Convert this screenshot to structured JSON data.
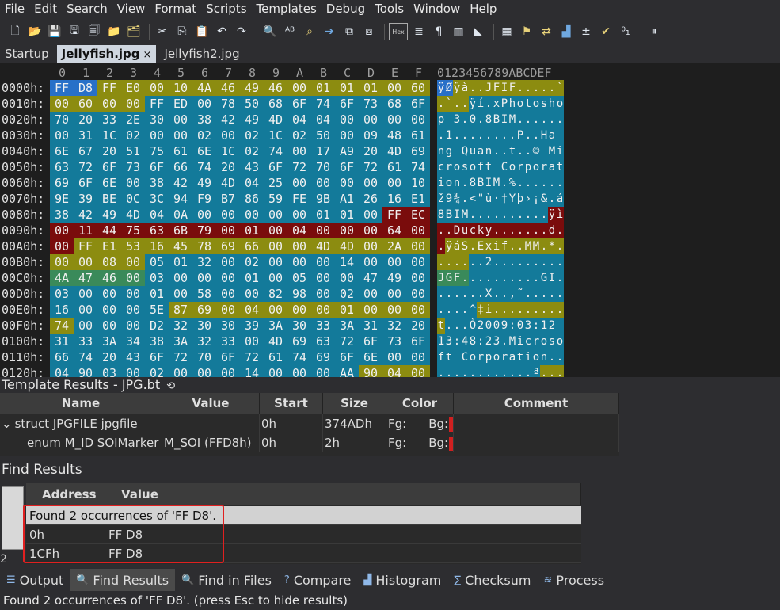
{
  "menu": [
    "File",
    "Edit",
    "Search",
    "View",
    "Format",
    "Scripts",
    "Templates",
    "Debug",
    "Tools",
    "Window",
    "Help"
  ],
  "toolbar": {
    "icons": [
      "new-file-icon",
      "open-icon",
      "save-icon",
      "save-as-icon",
      "save-all-icon",
      "open-folder-icon",
      "open-project-icon",
      "cut-icon",
      "copy-icon",
      "paste-icon",
      "undo-icon",
      "redo-icon",
      "find-icon",
      "replace-icon",
      "find-in-files-icon",
      "goto-icon",
      "compare-icon",
      "compare2-icon",
      "hex-icon",
      "text-format-icon",
      "pilcrow-icon",
      "columns-icon",
      "highlight-icon",
      "calculator-icon",
      "bookmark-icon",
      "swap-icon",
      "histogram-icon",
      "checksum-icon",
      "check-icon",
      "base-convert-icon",
      "pause-icon"
    ],
    "hex_label": "Hex"
  },
  "tabs": [
    {
      "label": "Startup",
      "active": false
    },
    {
      "label": "Jellyfish.jpg",
      "active": true,
      "close": "×"
    },
    {
      "label": "Jellyfish2.jpg",
      "active": false
    }
  ],
  "hex": {
    "col_headers": [
      "0",
      "1",
      "2",
      "3",
      "4",
      "5",
      "6",
      "7",
      "8",
      "9",
      "A",
      "B",
      "C",
      "D",
      "E",
      "F"
    ],
    "ascii_header": "0123456789ABCDEF",
    "colors": {
      "blue": "#2870c8",
      "olive": "#8c8c10",
      "teal": "#137a9a",
      "red": "#7a0c0c",
      "green": "#3a8a5a",
      "dark": "#1e1e1e"
    },
    "rows": [
      {
        "addr": "0000h:",
        "bytes": [
          "FF",
          "D8",
          "FF",
          "E0",
          "00",
          "10",
          "4A",
          "46",
          "49",
          "46",
          "00",
          "01",
          "01",
          "01",
          "00",
          "60"
        ],
        "ascii": "ÿØÿà..JFIF.....`",
        "fill": [
          "blue",
          "blue",
          "olive",
          "olive",
          "olive",
          "olive",
          "olive",
          "olive",
          "olive",
          "olive",
          "olive",
          "olive",
          "olive",
          "olive",
          "olive",
          "olive"
        ]
      },
      {
        "addr": "0010h:",
        "bytes": [
          "00",
          "60",
          "00",
          "00",
          "FF",
          "ED",
          "00",
          "78",
          "50",
          "68",
          "6F",
          "74",
          "6F",
          "73",
          "68",
          "6F"
        ],
        "ascii": ".`..ÿí.xPhotosho",
        "fill": [
          "olive",
          "olive",
          "olive",
          "olive",
          "teal",
          "teal",
          "teal",
          "teal",
          "teal",
          "teal",
          "teal",
          "teal",
          "teal",
          "teal",
          "teal",
          "teal"
        ]
      },
      {
        "addr": "0020h:",
        "bytes": [
          "70",
          "20",
          "33",
          "2E",
          "30",
          "00",
          "38",
          "42",
          "49",
          "4D",
          "04",
          "04",
          "00",
          "00",
          "00",
          "00"
        ],
        "ascii": "p 3.0.8BIM......",
        "fill": [
          "teal",
          "teal",
          "teal",
          "teal",
          "teal",
          "teal",
          "teal",
          "teal",
          "teal",
          "teal",
          "teal",
          "teal",
          "teal",
          "teal",
          "teal",
          "teal"
        ]
      },
      {
        "addr": "0030h:",
        "bytes": [
          "00",
          "31",
          "1C",
          "02",
          "00",
          "00",
          "02",
          "00",
          "02",
          "1C",
          "02",
          "50",
          "00",
          "09",
          "48",
          "61"
        ],
        "ascii": ".1........P..Ha",
        "fill": [
          "teal",
          "teal",
          "teal",
          "teal",
          "teal",
          "teal",
          "teal",
          "teal",
          "teal",
          "teal",
          "teal",
          "teal",
          "teal",
          "teal",
          "teal",
          "teal"
        ]
      },
      {
        "addr": "0040h:",
        "bytes": [
          "6E",
          "67",
          "20",
          "51",
          "75",
          "61",
          "6E",
          "1C",
          "02",
          "74",
          "00",
          "17",
          "A9",
          "20",
          "4D",
          "69"
        ],
        "ascii": "ng Quan..t..© Mi",
        "fill": [
          "teal",
          "teal",
          "teal",
          "teal",
          "teal",
          "teal",
          "teal",
          "teal",
          "teal",
          "teal",
          "teal",
          "teal",
          "teal",
          "teal",
          "teal",
          "teal"
        ]
      },
      {
        "addr": "0050h:",
        "bytes": [
          "63",
          "72",
          "6F",
          "73",
          "6F",
          "66",
          "74",
          "20",
          "43",
          "6F",
          "72",
          "70",
          "6F",
          "72",
          "61",
          "74"
        ],
        "ascii": "crosoft Corporat",
        "fill": [
          "teal",
          "teal",
          "teal",
          "teal",
          "teal",
          "teal",
          "teal",
          "teal",
          "teal",
          "teal",
          "teal",
          "teal",
          "teal",
          "teal",
          "teal",
          "teal"
        ]
      },
      {
        "addr": "0060h:",
        "bytes": [
          "69",
          "6F",
          "6E",
          "00",
          "38",
          "42",
          "49",
          "4D",
          "04",
          "25",
          "00",
          "00",
          "00",
          "00",
          "00",
          "10"
        ],
        "ascii": "ion.8BIM.%......",
        "fill": [
          "teal",
          "teal",
          "teal",
          "teal",
          "teal",
          "teal",
          "teal",
          "teal",
          "teal",
          "teal",
          "teal",
          "teal",
          "teal",
          "teal",
          "teal",
          "teal"
        ]
      },
      {
        "addr": "0070h:",
        "bytes": [
          "9E",
          "39",
          "BE",
          "0C",
          "3C",
          "94",
          "F9",
          "B7",
          "86",
          "59",
          "FE",
          "9B",
          "A1",
          "26",
          "16",
          "E1"
        ],
        "ascii": "ž9¾.<\"ù·†Yþ›¡&.á",
        "fill": [
          "teal",
          "teal",
          "teal",
          "teal",
          "teal",
          "teal",
          "teal",
          "teal",
          "teal",
          "teal",
          "teal",
          "teal",
          "teal",
          "teal",
          "teal",
          "teal"
        ]
      },
      {
        "addr": "0080h:",
        "bytes": [
          "38",
          "42",
          "49",
          "4D",
          "04",
          "0A",
          "00",
          "00",
          "00",
          "00",
          "00",
          "01",
          "01",
          "00",
          "FF",
          "EC"
        ],
        "ascii": "8BIM..........ÿì",
        "fill": [
          "teal",
          "teal",
          "teal",
          "teal",
          "teal",
          "teal",
          "teal",
          "teal",
          "teal",
          "teal",
          "teal",
          "teal",
          "teal",
          "teal",
          "red",
          "red"
        ]
      },
      {
        "addr": "0090h:",
        "bytes": [
          "00",
          "11",
          "44",
          "75",
          "63",
          "6B",
          "79",
          "00",
          "01",
          "00",
          "04",
          "00",
          "00",
          "00",
          "64",
          "00"
        ],
        "ascii": "..Ducky.......d.",
        "fill": [
          "red",
          "red",
          "red",
          "red",
          "red",
          "red",
          "red",
          "red",
          "red",
          "red",
          "red",
          "red",
          "red",
          "red",
          "red",
          "red"
        ]
      },
      {
        "addr": "00A0h:",
        "bytes": [
          "00",
          "FF",
          "E1",
          "53",
          "16",
          "45",
          "78",
          "69",
          "66",
          "00",
          "00",
          "4D",
          "4D",
          "00",
          "2A",
          "00"
        ],
        "ascii": ".ÿáS.Exif..MM.*.",
        "fill": [
          "red",
          "olive",
          "olive",
          "olive",
          "olive",
          "olive",
          "olive",
          "olive",
          "olive",
          "olive",
          "olive",
          "olive",
          "olive",
          "olive",
          "olive",
          "olive"
        ]
      },
      {
        "addr": "00B0h:",
        "bytes": [
          "00",
          "00",
          "08",
          "00",
          "05",
          "01",
          "32",
          "00",
          "02",
          "00",
          "00",
          "00",
          "14",
          "00",
          "00",
          "00"
        ],
        "ascii": "......2.........",
        "fill": [
          "olive",
          "olive",
          "olive",
          "olive",
          "teal",
          "teal",
          "teal",
          "teal",
          "teal",
          "teal",
          "teal",
          "teal",
          "teal",
          "teal",
          "teal",
          "teal"
        ]
      },
      {
        "addr": "00C0h:",
        "bytes": [
          "4A",
          "47",
          "46",
          "00",
          "03",
          "00",
          "00",
          "00",
          "01",
          "00",
          "05",
          "00",
          "00",
          "47",
          "49",
          "00"
        ],
        "ascii": "JGF..........GI.",
        "fill": [
          "green",
          "green",
          "green",
          "green",
          "teal",
          "teal",
          "teal",
          "teal",
          "teal",
          "teal",
          "teal",
          "teal",
          "teal",
          "teal",
          "teal",
          "teal"
        ]
      },
      {
        "addr": "00D0h:",
        "bytes": [
          "03",
          "00",
          "00",
          "00",
          "01",
          "00",
          "58",
          "00",
          "00",
          "82",
          "98",
          "00",
          "02",
          "00",
          "00",
          "00"
        ],
        "ascii": "......X..‚˜.....",
        "fill": [
          "teal",
          "teal",
          "teal",
          "teal",
          "teal",
          "teal",
          "teal",
          "teal",
          "teal",
          "teal",
          "teal",
          "teal",
          "teal",
          "teal",
          "teal",
          "teal"
        ]
      },
      {
        "addr": "00E0h:",
        "bytes": [
          "16",
          "00",
          "00",
          "00",
          "5E",
          "87",
          "69",
          "00",
          "04",
          "00",
          "00",
          "00",
          "01",
          "00",
          "00",
          "00"
        ],
        "ascii": "....^‡i.........",
        "fill": [
          "teal",
          "teal",
          "teal",
          "teal",
          "teal",
          "olive",
          "olive",
          "olive",
          "olive",
          "olive",
          "olive",
          "olive",
          "olive",
          "olive",
          "olive",
          "olive"
        ]
      },
      {
        "addr": "00F0h:",
        "bytes": [
          "74",
          "00",
          "00",
          "00",
          "D2",
          "32",
          "30",
          "30",
          "39",
          "3A",
          "30",
          "33",
          "3A",
          "31",
          "32",
          "20"
        ],
        "ascii": "t...Ò2009:03:12 ",
        "fill": [
          "olive",
          "teal",
          "teal",
          "teal",
          "teal",
          "teal",
          "teal",
          "teal",
          "teal",
          "teal",
          "teal",
          "teal",
          "teal",
          "teal",
          "teal",
          "teal"
        ]
      },
      {
        "addr": "0100h:",
        "bytes": [
          "31",
          "33",
          "3A",
          "34",
          "38",
          "3A",
          "32",
          "33",
          "00",
          "4D",
          "69",
          "63",
          "72",
          "6F",
          "73",
          "6F"
        ],
        "ascii": "13:48:23.Microso",
        "fill": [
          "teal",
          "teal",
          "teal",
          "teal",
          "teal",
          "teal",
          "teal",
          "teal",
          "teal",
          "teal",
          "teal",
          "teal",
          "teal",
          "teal",
          "teal",
          "teal"
        ]
      },
      {
        "addr": "0110h:",
        "bytes": [
          "66",
          "74",
          "20",
          "43",
          "6F",
          "72",
          "70",
          "6F",
          "72",
          "61",
          "74",
          "69",
          "6F",
          "6E",
          "00",
          "00"
        ],
        "ascii": "ft Corporation..",
        "fill": [
          "teal",
          "teal",
          "teal",
          "teal",
          "teal",
          "teal",
          "teal",
          "teal",
          "teal",
          "teal",
          "teal",
          "teal",
          "teal",
          "teal",
          "teal",
          "teal"
        ]
      },
      {
        "addr": "0120h:",
        "bytes": [
          "04",
          "90",
          "03",
          "00",
          "02",
          "00",
          "00",
          "00",
          "14",
          "00",
          "00",
          "00",
          "AA",
          "90",
          "04",
          "00"
        ],
        "ascii": "............ª...",
        "fill": [
          "teal",
          "teal",
          "teal",
          "teal",
          "teal",
          "teal",
          "teal",
          "teal",
          "teal",
          "teal",
          "teal",
          "teal",
          "teal",
          "olive",
          "olive",
          "olive"
        ]
      }
    ]
  },
  "template": {
    "title": "Template Results - JPG.bt",
    "refresh_icon": "refresh-icon",
    "columns": [
      "Name",
      "Value",
      "Start",
      "Size",
      "Color",
      "Comment"
    ],
    "rows": [
      {
        "name": "struct JPGFILE jpgfile",
        "value": "",
        "start": "0h",
        "size": "374ADh",
        "fg": "Fg:",
        "bg": "Bg:",
        "swatch": "#d02020",
        "expander": "⌄"
      },
      {
        "name": "enum M_ID SOIMarker",
        "value": "M_SOI (FFD8h)",
        "start": "0h",
        "size": "2h",
        "fg": "Fg:",
        "bg": "Bg:",
        "swatch": "#d02020",
        "expander": ""
      }
    ]
  },
  "find": {
    "title": "Find Results",
    "columns": [
      "Address",
      "Value"
    ],
    "rows": [
      {
        "address": "Found 2 occurrences of 'FF D8'.",
        "value": "",
        "summary": true
      },
      {
        "address": "0h",
        "value": "FF D8"
      },
      {
        "address": "1CFh",
        "value": "FF D8"
      }
    ],
    "left_count": "2"
  },
  "bottom_tabs": [
    {
      "label": "Output",
      "icon": "output-icon",
      "glyph": "☰",
      "active": false
    },
    {
      "label": "Find Results",
      "icon": "find-results-icon",
      "glyph": "🔍",
      "active": true
    },
    {
      "label": "Find in Files",
      "icon": "find-in-files-icon",
      "glyph": "🔍",
      "active": false
    },
    {
      "label": "Compare",
      "icon": "compare-icon",
      "glyph": "?",
      "active": false
    },
    {
      "label": "Histogram",
      "icon": "histogram-icon",
      "glyph": "▟",
      "active": false
    },
    {
      "label": "Checksum",
      "icon": "checksum-icon",
      "glyph": "∑",
      "active": false
    },
    {
      "label": "Process",
      "icon": "process-icon",
      "glyph": "≋",
      "active": false
    }
  ],
  "status": "Found 2 occurrences of 'FF D8'. (press Esc to hide results)"
}
